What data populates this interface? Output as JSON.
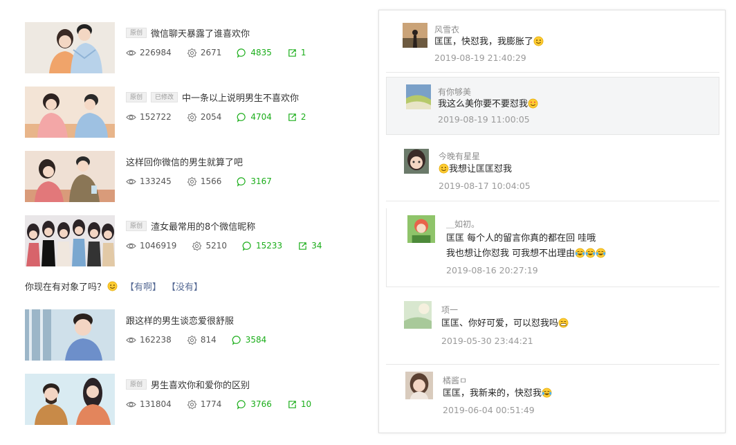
{
  "articles": [
    {
      "tags": [
        "原创"
      ],
      "title": "微信聊天暴露了谁喜欢你",
      "views": "226984",
      "likes": "2671",
      "comments": "4835",
      "shares": "1",
      "image": "couple-illustration"
    },
    {
      "tags": [
        "原创",
        "已修改"
      ],
      "title": "中一条以上说明男生不喜欢你",
      "views": "152722",
      "likes": "2054",
      "comments": "4704",
      "shares": "2",
      "image": "couple-on-sofa-illustration"
    },
    {
      "tags": [],
      "title": "这样回你微信的男生就算了吧",
      "views": "133245",
      "likes": "1566",
      "comments": "3167",
      "shares": "",
      "image": "couple-at-table-illustration"
    },
    {
      "tags": [
        "原创"
      ],
      "title": "渣女最常用的8个微信昵称",
      "views": "1046919",
      "likes": "5210",
      "comments": "15233",
      "shares": "34",
      "image": "group-of-women-illustration"
    },
    {
      "tags": [],
      "title": "跟这样的男生谈恋爱很舒服",
      "views": "162238",
      "likes": "814",
      "comments": "3584",
      "shares": "",
      "image": "man-at-window-illustration"
    },
    {
      "tags": [
        "原创"
      ],
      "title": "男生喜欢你和爱你的区别",
      "views": "131804",
      "likes": "1774",
      "comments": "3766",
      "shares": "10",
      "image": "bearded-man-and-woman-illustration"
    }
  ],
  "poll": {
    "question": "你现在有对象了吗？",
    "option_yes": "【有啊】",
    "option_no": "【没有】"
  },
  "comments": [
    {
      "name": "风雪衣",
      "text": "匡匡，快怼我，我膨胀了",
      "time": "2019-08-19 21:40:29",
      "emoji": "smile",
      "emoji_count": 1
    },
    {
      "name": "有你够美",
      "text": "我这么美你要不要怼我",
      "time": "2019-08-19 11:00:05",
      "emoji": "heart-eyes",
      "emoji_count": 1
    },
    {
      "name": "今晚有星星",
      "text_after_emoji": "我想让匡匡怼我",
      "time": "2019-08-17 10:04:05",
      "emoji": "smile"
    },
    {
      "name": "＿如初。",
      "text_line1": "匡匡 每个人的留言你真的都在回 哇哦",
      "text_line2": "我也想让你怼我 可我想不出理由",
      "time": "2019-08-16 20:27:19",
      "emoji": "tears-of-joy",
      "emoji_count": 3
    },
    {
      "name": "项一",
      "text": "匡匡、你好可爱，可以怼我吗",
      "time": "2019-05-30 23:44:21",
      "emoji": "grin",
      "emoji_count": 1
    },
    {
      "name": "橘酱ㅁ",
      "text": "匡匡，我新来的，快怼我",
      "time": "2019-06-04 00:51:49",
      "emoji": "tears-of-joy",
      "emoji_count": 1
    }
  ],
  "colors": {
    "accent_green": "#1aad19",
    "link_blue": "#576b95",
    "timestamp_gray": "#9a9a9a"
  }
}
